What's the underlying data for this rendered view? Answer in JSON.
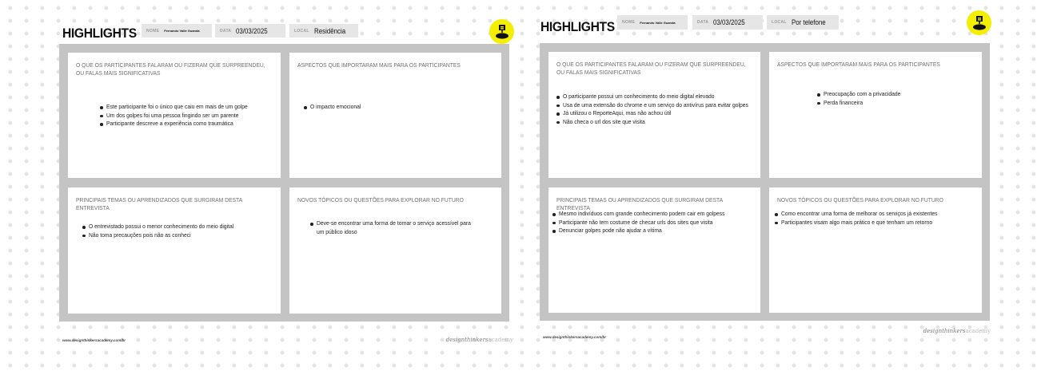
{
  "boards": [
    {
      "title": "HIGHLIGHTS",
      "fields": {
        "name_label": "NOME",
        "name_value": "Fernando Valle Guanda",
        "date_label": "DATA",
        "date_value": "03/03/2025",
        "local_label": "LOCAL",
        "local_value": "Residência"
      },
      "cards": [
        {
          "title": "O QUE OS PARTICIPANTES FALARAM OU FIZERAM QUE SURPREENDEU, OU FALAS MAIS SIGNIFICATIVAS",
          "items": [
            "Este participante foi o único que caiu em mais de um golpe",
            "Um dos golpes foi uma pessoa fingindo ser um parente",
            "Participante descreve a experiência como traumática"
          ]
        },
        {
          "title": "ASPECTOS QUE IMPORTARAM MAIS PARA OS PARTICIPANTES",
          "items": [
            "O impacto emocional"
          ]
        },
        {
          "title": "PRINCIPAIS TEMAS OU APRENDIZADOS QUE SURGIRAM DESTA ENTREVISTA",
          "items": [
            "O entrevistado possui o menor conhecimento do meio digital",
            "Não toma precauções pois não as conheci"
          ]
        },
        {
          "title": "NOVOS TÓPICOS OU QUESTÕES PARA EXPLORAR NO FUTURO",
          "items": [
            "Deve-se encontrar uma forma de tornar o serviço acessível para um público idoso"
          ]
        }
      ],
      "footer": {
        "url": "www.designthinkersacademy.com/br",
        "brand_a": "designthinkers",
        "brand_b": "academy"
      }
    },
    {
      "title": "HIGHLIGHTS",
      "fields": {
        "name_label": "NOME",
        "name_value": "Fernando Valle Guanda",
        "date_label": "DATA",
        "date_value": "03/03/2025",
        "local_label": "LOCAL",
        "local_value": "Por telefone"
      },
      "cards": [
        {
          "title": "O QUE OS PARTICIPANTES FALARAM OU FIZERAM QUE SURPREENDEU, OU FALAS MAIS SIGNIFICATIVAS",
          "items": [
            "O participante possui um conhecimento do meio digital elevado",
            "Usa de uma extensão do chrome e um serviço do antivírus para evitar golpes",
            "Já utilizou o ReporteAqui, mas não achou útil",
            "Não checa o url dos site que visita"
          ]
        },
        {
          "title": "ASPECTOS QUE IMPORTARAM MAIS PARA OS PARTICIPANTES",
          "items": [
            "Preocupação com a privacidade",
            "Perda financeira"
          ]
        },
        {
          "title": "PRINCIPAIS TEMAS OU APRENDIZADOS QUE SURGIRAM DESTA ENTREVISTA",
          "items": [
            "Mesmo indivíduos com grande conhecimento podem cair em golpess",
            "Participante não tem costume de checar urls dos sites que visita",
            "Denunciar golpes pode não ajudar a vítima"
          ]
        },
        {
          "title": "NOVOS TÓPICOS OU QUESTÕES PARA EXPLORAR NO FUTURO",
          "items": [
            "Como encontrar uma forma de melhorar os serviços já existentes",
            "Participantes visam algo mais prático e que tenham um retorno"
          ]
        }
      ],
      "footer": {
        "url": "www.designthinkersacademy.com/br",
        "brand_a": "designthinkers",
        "brand_b": "academy"
      }
    }
  ],
  "colors": {
    "logo_yellow": "#f4ee00",
    "frame_gray": "#c4c4c4",
    "field_gray": "#e6e6e6"
  },
  "icons": {
    "logo": "design-thinkers-logo-icon"
  }
}
